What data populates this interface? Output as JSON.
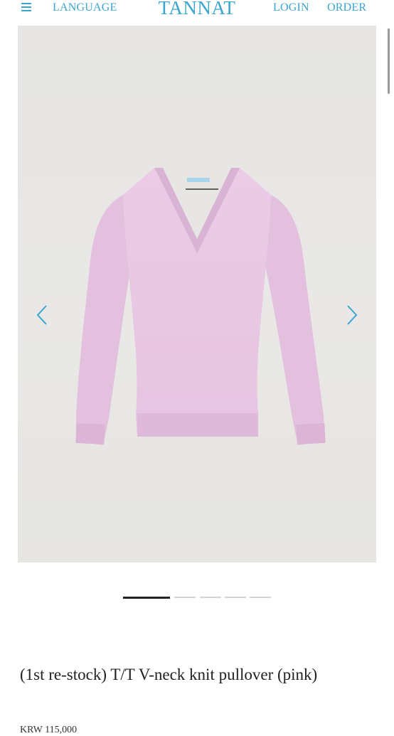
{
  "header": {
    "menu_icon": "hamburger-menu-icon",
    "language_label": "LANGUAGE",
    "logo": "TANNAT",
    "login_label": "LOGIN",
    "order_label": "ORDER",
    "accent_color": "#3aa5d0"
  },
  "gallery": {
    "product_color": "#e8c7e3",
    "background_color": "#e7e6e4",
    "prev_icon": "chevron-left-icon",
    "next_icon": "chevron-right-icon",
    "slide_count": 5,
    "active_slide": 1
  },
  "product": {
    "title": "(1st re-stock) T/T V-neck knit pullover (pink)",
    "price": "KRW 115,000"
  }
}
